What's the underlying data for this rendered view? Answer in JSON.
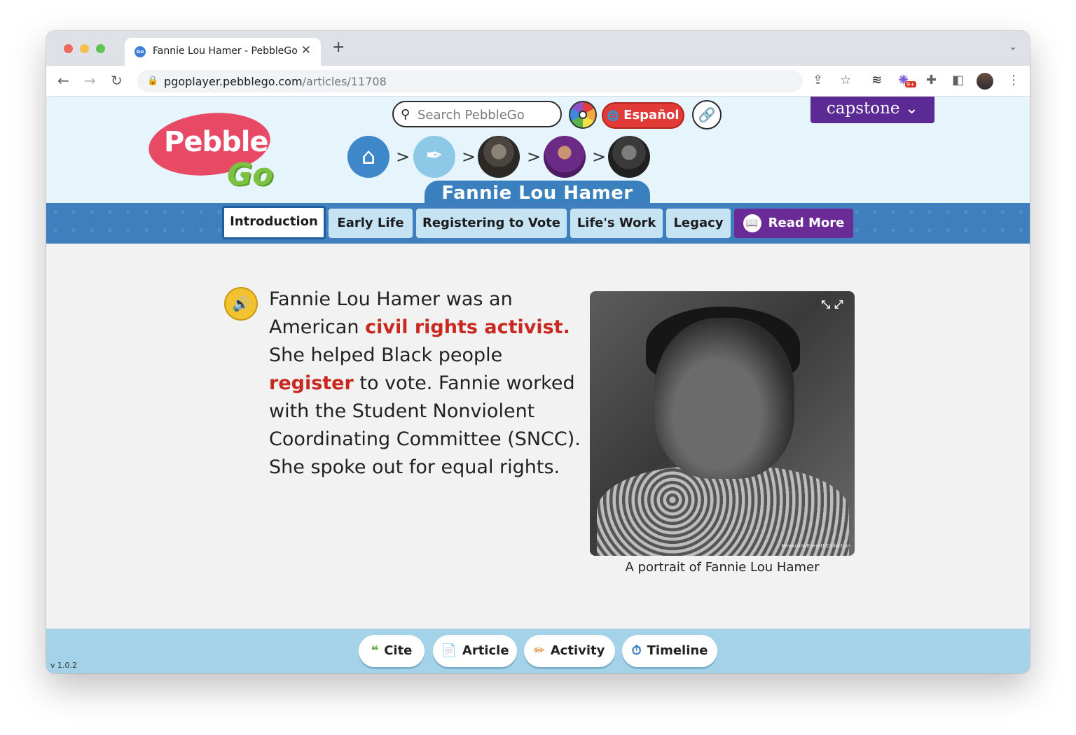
{
  "browser": {
    "tab_title": "Fannie Lou Hamer - PebbleGo",
    "tab_favicon": "Go",
    "tab_close": "✕",
    "new_tab": "+",
    "tab_menu": "⌄",
    "url_host": "pgoplayer.pebblego.com",
    "url_path": "/articles/11708",
    "back": "←",
    "forward": "→",
    "reload": "↻",
    "lock": "🔒",
    "extension_badge": "9+"
  },
  "header": {
    "logo_pebble": "Pebble",
    "logo_go": "Go",
    "search_placeholder": "Search PebbleGo",
    "espanol_label": "Español",
    "espanol_icon": "🌐",
    "link_icon": "🔗",
    "capstone_label": "capstone ⌄",
    "breadcrumb_sep": ">",
    "home_icon": "⌂",
    "quill_icon": "✒",
    "article_title": "Fannie Lou Hamer"
  },
  "tabs": [
    {
      "label": "Introduction"
    },
    {
      "label": "Early Life"
    },
    {
      "label": "Registering to Vote"
    },
    {
      "label": "Life's Work"
    },
    {
      "label": "Legacy"
    },
    {
      "label": "Read More"
    }
  ],
  "article": {
    "speaker_icon": "🔊",
    "text1": "Fannie Lou Hamer was an American ",
    "vocab1": "civil rights activist.",
    "text2": " She helped Black people ",
    "vocab2": "register",
    "text3": " to vote. Fannie worked with the Student Nonviolent Coordinating Committee (SNCC). She spoke out for equal rights.",
    "expand_icon": "⤡ ⤢",
    "photo_credit": "Newscom/Everett Collection",
    "caption": "A portrait of Fannie Lou Hamer"
  },
  "footer": {
    "buttons": [
      {
        "label": "Cite",
        "icon": "❝"
      },
      {
        "label": "Article",
        "icon": "📄"
      },
      {
        "label": "Activity",
        "icon": "✏"
      },
      {
        "label": "Timeline",
        "icon": "⏱"
      }
    ],
    "version": "v 1.0.2"
  }
}
